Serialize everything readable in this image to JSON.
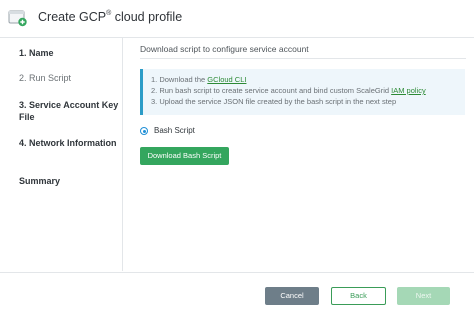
{
  "header": {
    "title_prefix": "Create GCP",
    "title_sup": "®",
    "title_suffix": "cloud profile",
    "icon": "cloud-add-icon"
  },
  "sidebar": {
    "steps": [
      {
        "label": "1. Name",
        "state": "done"
      },
      {
        "label": "2. Run Script",
        "state": "current"
      },
      {
        "label": "3. Service Account Key File",
        "state": "pending"
      },
      {
        "label": "4. Network Information",
        "state": "pending"
      },
      {
        "label": "Summary",
        "state": "pending"
      }
    ]
  },
  "main": {
    "section_title": "Download script to configure service account",
    "instructions": {
      "line1_prefix": "1. Download the ",
      "line1_link": "GCloud CLI",
      "line2_prefix": "2. Run bash script to create service account and bind custom ScaleGrid ",
      "line2_link": "IAM policy",
      "line3": "3. Upload the service JSON file created by the bash script in the next step"
    },
    "radio_label": "Bash Script",
    "download_button": "Download Bash Script"
  },
  "footer": {
    "cancel": "Cancel",
    "back": "Back",
    "next": "Next"
  },
  "colors": {
    "accent_green": "#34a65e",
    "info_blue": "#2b9cc7",
    "cancel_gray": "#6e7e89",
    "next_disabled": "#a5d8b6"
  }
}
